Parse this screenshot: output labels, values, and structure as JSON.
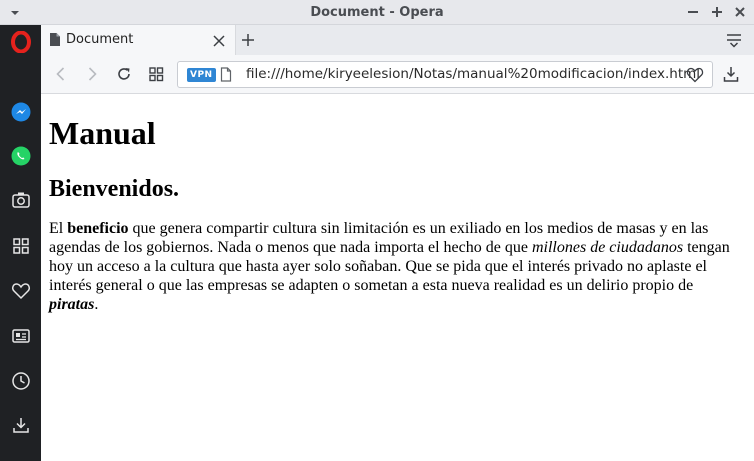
{
  "window": {
    "title": "Document - Opera"
  },
  "tabs": [
    {
      "label": "Document"
    }
  ],
  "addressbar": {
    "vpn_label": "VPN",
    "url": "file:///home/kiryeelesion/Notas/manual%20modificacion/index.html"
  },
  "sidebar": {
    "items": [
      {
        "icon": "opera-logo-icon"
      },
      {
        "icon": "messenger-icon",
        "color": "#1e88e5"
      },
      {
        "icon": "whatsapp-icon",
        "color": "#25d366"
      },
      {
        "icon": "camera-icon"
      },
      {
        "icon": "speed-dial-icon"
      },
      {
        "icon": "heart-icon"
      },
      {
        "icon": "news-icon"
      },
      {
        "icon": "history-icon"
      },
      {
        "icon": "downloads-icon"
      }
    ]
  },
  "colors": {
    "opera_red": "#e5221d",
    "sidebar_bg": "#1f2124",
    "vpn_blue": "#2f86d4"
  },
  "page": {
    "h1": "Manual",
    "h2": "Bienvenidos.",
    "paragraph": {
      "t1": "El ",
      "b1": "beneficio",
      "t2": " que genera compartir cultura sin limitación es un exiliado en los medios de masas y en las agendas de los gobiernos. Nada o menos que nada importa el hecho de que ",
      "i1": "millones de ciudadanos",
      "t3": " tengan hoy un acceso a la cultura que hasta ayer solo soñaban. Que se pida que el interés privado no aplaste el interés general o que las empresas se adapten o sometan a esta nueva realidad es un delirio propio de ",
      "bi1": "piratas",
      "t4": "."
    }
  }
}
